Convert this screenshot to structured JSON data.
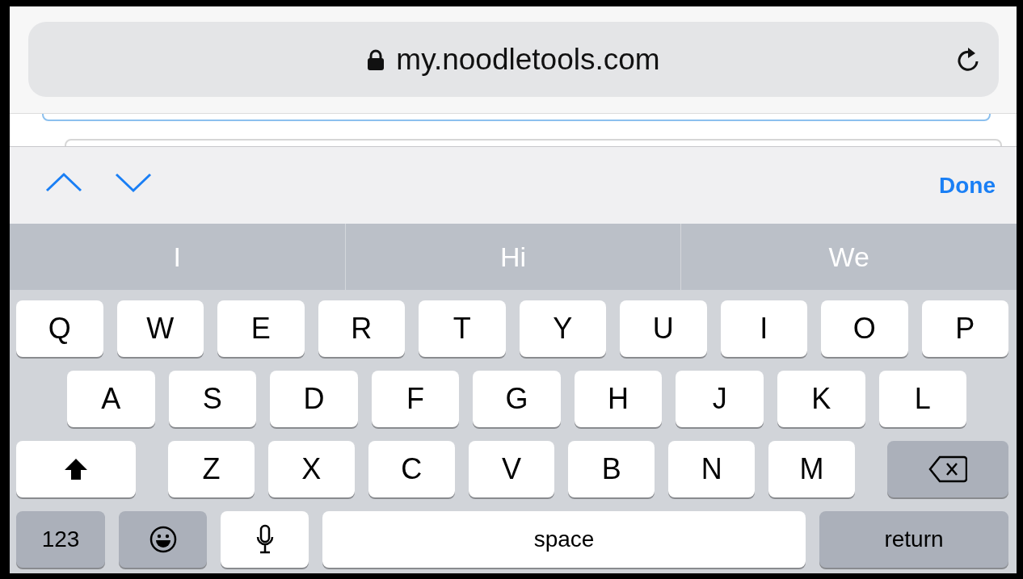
{
  "address_bar": {
    "url": "my.noodletools.com",
    "secure": true
  },
  "form_accessory": {
    "done": "Done"
  },
  "suggestions": [
    {
      "text": "I"
    },
    {
      "text": "Hi"
    },
    {
      "text": "We"
    }
  ],
  "keyboard": {
    "rows": [
      [
        {
          "kind": "letter",
          "label": "Q"
        },
        {
          "kind": "letter",
          "label": "W"
        },
        {
          "kind": "letter",
          "label": "E"
        },
        {
          "kind": "letter",
          "label": "R"
        },
        {
          "kind": "letter",
          "label": "T"
        },
        {
          "kind": "letter",
          "label": "Y"
        },
        {
          "kind": "letter",
          "label": "U"
        },
        {
          "kind": "letter",
          "label": "I"
        },
        {
          "kind": "letter",
          "label": "O"
        },
        {
          "kind": "letter",
          "label": "P"
        }
      ],
      [
        {
          "kind": "letter",
          "label": "A"
        },
        {
          "kind": "letter",
          "label": "S"
        },
        {
          "kind": "letter",
          "label": "D"
        },
        {
          "kind": "letter",
          "label": "F"
        },
        {
          "kind": "letter",
          "label": "G"
        },
        {
          "kind": "letter",
          "label": "H"
        },
        {
          "kind": "letter",
          "label": "J"
        },
        {
          "kind": "letter",
          "label": "K"
        },
        {
          "kind": "letter",
          "label": "L"
        }
      ],
      [
        {
          "kind": "shift"
        },
        {
          "kind": "letter",
          "label": "Z"
        },
        {
          "kind": "letter",
          "label": "X"
        },
        {
          "kind": "letter",
          "label": "C"
        },
        {
          "kind": "letter",
          "label": "V"
        },
        {
          "kind": "letter",
          "label": "B"
        },
        {
          "kind": "letter",
          "label": "N"
        },
        {
          "kind": "letter",
          "label": "M"
        },
        {
          "kind": "delete"
        }
      ],
      [
        {
          "kind": "numbers",
          "label": "123"
        },
        {
          "kind": "emoji"
        },
        {
          "kind": "mic"
        },
        {
          "kind": "space",
          "label": "space"
        },
        {
          "kind": "return",
          "label": "return"
        }
      ]
    ]
  }
}
